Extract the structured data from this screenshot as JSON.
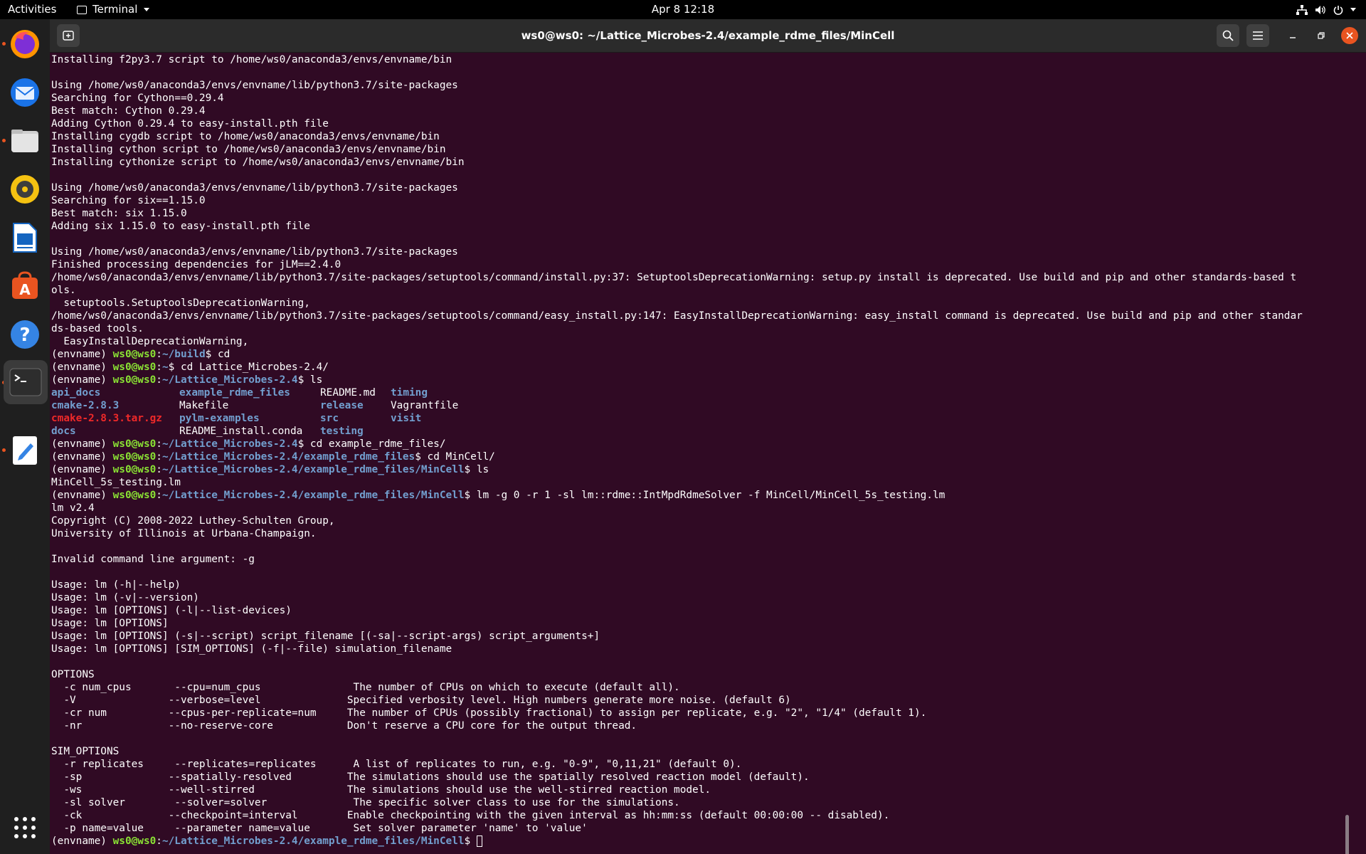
{
  "topbar": {
    "activities": "Activities",
    "app_name": "Terminal",
    "clock": "Apr 8  12:18"
  },
  "dock": {
    "apps": [
      "firefox-icon",
      "thunderbird-icon",
      "files-icon",
      "rhythmbox-icon",
      "libreoffice-writer-icon",
      "app-center-icon",
      "help-icon",
      "terminal-icon",
      "text-editor-icon"
    ],
    "show_apps": "show-apps-icon"
  },
  "window": {
    "title": "ws0@ws0: ~/Lattice_Microbes-2.4/example_rdme_files/MinCell"
  },
  "colors": {
    "terminal_bg": "#300a24",
    "user_host": "#8ae234",
    "path": "#729fcf",
    "archive": "#ef2929"
  },
  "terminal": {
    "l01": "Installing f2py3.7 script to /home/ws0/anaconda3/envs/envname/bin",
    "l02": "Using /home/ws0/anaconda3/envs/envname/lib/python3.7/site-packages",
    "l03": "Searching for Cython==0.29.4",
    "l04": "Best match: Cython 0.29.4",
    "l05": "Adding Cython 0.29.4 to easy-install.pth file",
    "l06": "Installing cygdb script to /home/ws0/anaconda3/envs/envname/bin",
    "l07": "Installing cython script to /home/ws0/anaconda3/envs/envname/bin",
    "l08": "Installing cythonize script to /home/ws0/anaconda3/envs/envname/bin",
    "l09": "Using /home/ws0/anaconda3/envs/envname/lib/python3.7/site-packages",
    "l10": "Searching for six==1.15.0",
    "l11": "Best match: six 1.15.0",
    "l12": "Adding six 1.15.0 to easy-install.pth file",
    "l13": "Using /home/ws0/anaconda3/envs/envname/lib/python3.7/site-packages",
    "l14": "Finished processing dependencies for jLM==2.4.0",
    "l15": "/home/ws0/anaconda3/envs/envname/lib/python3.7/site-packages/setuptools/command/install.py:37: SetuptoolsDeprecationWarning: setup.py install is deprecated. Use build and pip and other standards-based t",
    "l16": "ols.",
    "l17": "  setuptools.SetuptoolsDeprecationWarning,",
    "l18": "/home/ws0/anaconda3/envs/envname/lib/python3.7/site-packages/setuptools/command/easy_install.py:147: EasyInstallDeprecationWarning: easy_install command is deprecated. Use build and pip and other standar",
    "l19": "ds-based tools.",
    "l20": "  EasyInstallDeprecationWarning,",
    "env": "(envname) ",
    "user": "ws0@ws0",
    "colon": ":",
    "path_build": "~/build",
    "path_home": "~",
    "path_lm": "~/Lattice_Microbes-2.4",
    "path_rdme": "~/Lattice_Microbes-2.4/example_rdme_files",
    "path_mincell": "~/Lattice_Microbes-2.4/example_rdme_files/MinCell",
    "cmd1": "$ cd",
    "cmd2": "$ cd Lattice_Microbes-2.4/",
    "cmd3": "$ ls",
    "cmd4": "$ cd example_rdme_files/",
    "cmd5": "$ cd MinCell/",
    "cmd6": "$ ls",
    "cmd7": "$ lm -g 0 -r 1 -sl lm::rdme::IntMpdRdmeSolver -f MinCell/MinCell_5s_testing.lm",
    "cmd8": "$ ",
    "ls_files": {
      "c1": [
        "api_docs",
        "cmake-2.8.3",
        "cmake-2.8.3.tar.gz",
        "docs"
      ],
      "c2": [
        "example_rdme_files",
        "Makefile",
        "pylm-examples",
        "README_install.conda"
      ],
      "c3": [
        "README.md",
        "release",
        "src",
        "testing"
      ],
      "c4": [
        "timing",
        "Vagrantfile",
        "visit"
      ]
    },
    "ls_mincell": "MinCell_5s_testing.lm",
    "o01": "lm v2.4",
    "o02": "Copyright (C) 2008-2022 Luthey-Schulten Group,",
    "o03": "University of Illinois at Urbana-Champaign.",
    "o04": "Invalid command line argument: -g",
    "o05": "Usage: lm (-h|--help)",
    "o06": "Usage: lm (-v|--version)",
    "o07": "Usage: lm [OPTIONS] (-l|--list-devices)",
    "o08": "Usage: lm [OPTIONS]",
    "o09": "Usage: lm [OPTIONS] (-s|--script) script_filename [(-sa|--script-args) script_arguments+]",
    "o10": "Usage: lm [OPTIONS] [SIM_OPTIONS] (-f|--file) simulation_filename",
    "o11": "OPTIONS",
    "o12": "  -c num_cpus       --cpu=num_cpus               The number of CPUs on which to execute (default all).",
    "o13": "  -V               --verbose=level              Specified verbosity level. High numbers generate more noise. (default 6)",
    "o14": "  -cr num          --cpus-per-replicate=num     The number of CPUs (possibly fractional) to assign per replicate, e.g. \"2\", \"1/4\" (default 1).",
    "o15": "  -nr              --no-reserve-core            Don't reserve a CPU core for the output thread.",
    "o16": "SIM_OPTIONS",
    "o17": "  -r replicates     --replicates=replicates      A list of replicates to run, e.g. \"0-9\", \"0,11,21\" (default 0).",
    "o18": "  -sp              --spatially-resolved         The simulations should use the spatially resolved reaction model (default).",
    "o19": "  -ws              --well-stirred               The simulations should use the well-stirred reaction model.",
    "o20": "  -sl solver        --solver=solver              The specific solver class to use for the simulations.",
    "o21": "  -ck              --checkpoint=interval        Enable checkpointing with the given interval as hh:mm:ss (default 00:00:00 -- disabled).",
    "o22": "  -p name=value     --parameter name=value       Set solver parameter 'name' to 'value'"
  }
}
